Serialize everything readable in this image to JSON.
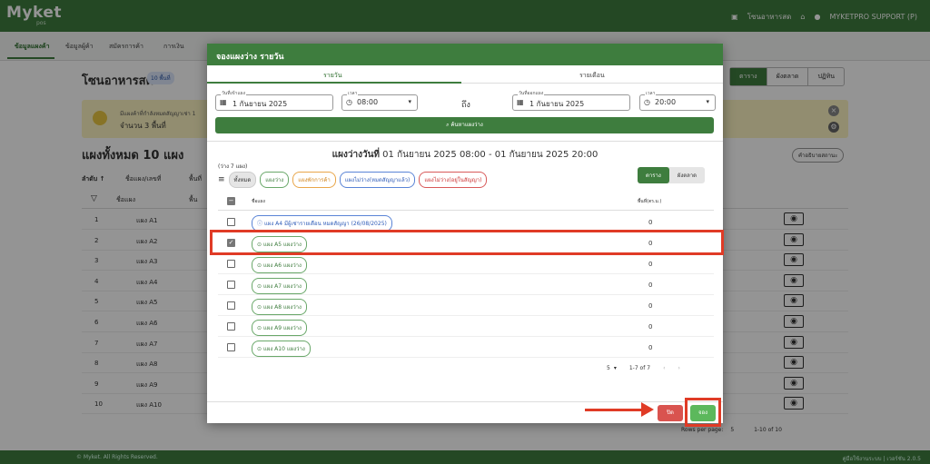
{
  "app": {
    "logo": "Myket",
    "logo_sub": "pos",
    "zone_link": "โซนอาหารสด",
    "user": "MYKETPRO SUPPORT (P)"
  },
  "nav": {
    "tabs": [
      "ข้อมูลแผงค้า",
      "ข้อมูลผู้ค้า",
      "สมัครการค้า",
      "การเงิน"
    ]
  },
  "page": {
    "title": "โซนอาหารสด",
    "badge": "10 พื้นที่",
    "views": [
      "ตาราง",
      "ผังตลาด",
      "ปฏิทิน"
    ],
    "banner_line1": "มีแผงค้าที่กำลังหมดสัญญาเช่า 1",
    "banner_line2": "จำนวน 3 พื้นที่",
    "list_title": "แผงทั้งหมด 10 แผง",
    "help_btn": "คำอธิบายสถานะ",
    "col_sort": "ลำดับ ↑",
    "col_name": "ชื่อแผง/เลขที่",
    "col_area": "พื้นที่",
    "filter_name": "ชื่อแผง",
    "filter_area": "พื้น",
    "rows": [
      {
        "n": "1",
        "name": "แผง A1"
      },
      {
        "n": "2",
        "name": "แผง A2"
      },
      {
        "n": "3",
        "name": "แผง A3"
      },
      {
        "n": "4",
        "name": "แผง A4"
      },
      {
        "n": "5",
        "name": "แผง A5"
      },
      {
        "n": "6",
        "name": "แผง A6"
      },
      {
        "n": "7",
        "name": "แผง A7"
      },
      {
        "n": "8",
        "name": "แผง A8"
      },
      {
        "n": "9",
        "name": "แผง A9"
      },
      {
        "n": "10",
        "name": "แผง A10"
      }
    ],
    "rows_per_page_label": "Rows per page:",
    "rows_per_page": "5",
    "page_range": "1-10 of 10"
  },
  "footer": {
    "left": "© Myket. All Rights Reserved.",
    "right": "คู่มือใช้งานระบบ | เวอร์ชัน 2.0.5"
  },
  "modal": {
    "title": "จองแผงว่าง รายวัน",
    "tabs": [
      "รายวัน",
      "รายเดือน"
    ],
    "start_date_label": "วันที่เข้าแผง",
    "start_date": "1 กันยายน 2025",
    "start_time_label": "เวลา",
    "start_time": "08:00",
    "to": "ถึง",
    "end_date_label": "วันที่ออกแผง",
    "end_date": "1 กันยายน 2025",
    "end_time_label": "เวลา",
    "end_time": "20:00",
    "search_btn": "ค้นหาแผงว่าง",
    "result_title_bold": "แผงว่างวันที่",
    "result_title_rest": " 01 กันยายน 2025 08:00 - 01 กันยายน 2025 20:00",
    "vacant_count": "(ว่าง 7 แผง)",
    "chips": [
      "ทั้งหมด",
      "แผงว่าง",
      "แผงพักการค้า",
      "แผงไม่ว่าง(หมดสัญญาแล้ว)",
      "แผงไม่ว่าง(อยู่ในสัญญา)"
    ],
    "view_toggle": [
      "ตาราง",
      "ผังตลาด"
    ],
    "col_name": "ชื่อแผง",
    "col_area": "พื้นที่(ตร.ม.)",
    "rows": [
      {
        "label": "แผง A4 มีผู้เช่ารายเดือน หมดสัญญา (26/08/2025)",
        "area": "0",
        "checked": false,
        "icon": "ⓘ",
        "kind": "blue"
      },
      {
        "label": "แผง A5 แผงว่าง",
        "area": "0",
        "checked": true,
        "icon": "⊙",
        "kind": "green"
      },
      {
        "label": "แผง A6 แผงว่าง",
        "area": "0",
        "checked": false,
        "icon": "⊙",
        "kind": "green"
      },
      {
        "label": "แผง A7 แผงว่าง",
        "area": "0",
        "checked": false,
        "icon": "⊙",
        "kind": "green"
      },
      {
        "label": "แผง A8 แผงว่าง",
        "area": "0",
        "checked": false,
        "icon": "⊙",
        "kind": "green"
      },
      {
        "label": "แผง A9 แผงว่าง",
        "area": "0",
        "checked": false,
        "icon": "⊙",
        "kind": "green"
      },
      {
        "label": "แผง A10 แผงว่าง",
        "area": "0",
        "checked": false,
        "icon": "⊙",
        "kind": "green"
      }
    ],
    "rows_per_page": "5",
    "page_range": "1-7 of 7",
    "close_btn": "ปิด",
    "book_btn": "จอง"
  },
  "colors": {
    "primary": "#3e7d3e",
    "highlight": "#e03b26"
  }
}
